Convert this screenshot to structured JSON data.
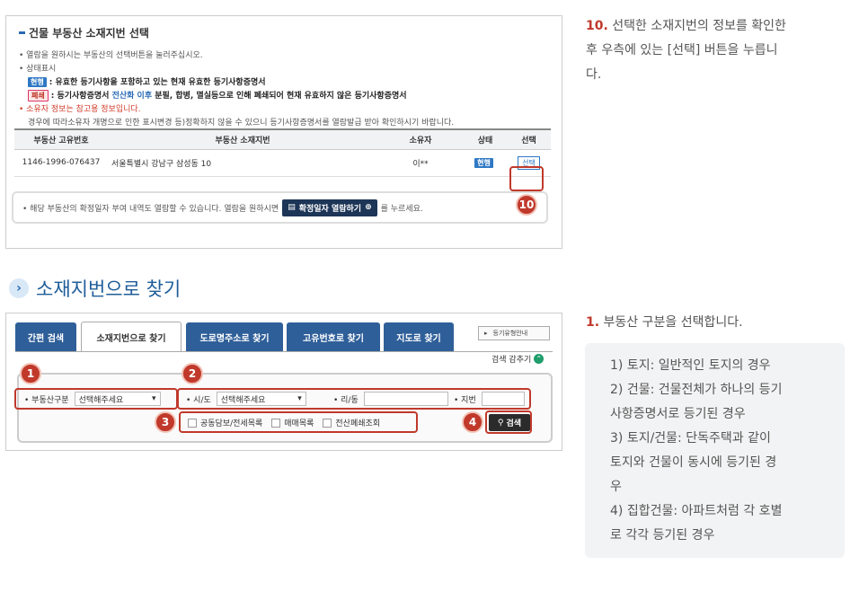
{
  "panel1": {
    "title": "건물 부동산 소재지번 선택",
    "notes": {
      "n1": "• 열람을 원하시는 부동산의 선택버튼을 눌러주십시오.",
      "n2": "• 상태표시",
      "badge_valid": "현행",
      "n3_bold": ": 유효한 등기사항을 포함하고 있는 현재 유효한 등기사항증명서",
      "badge_closed": "폐쇄",
      "n4_a": ": 등기사항증명서 ",
      "n4_b": "전산화 이후",
      "n4_c": " 분필, 합병, 멸실등으로 인해 폐쇄되어 현재 유효하지 않은 등기사항증명서",
      "n5": "• 소유자 정보는 참고용 정보입니다.",
      "n6": "경우에 따라소유자 개명으로 인한 표시변경 등)정확하지 않을 수 있으니 등기사항증명서를 열람발급 받아 확인하시기 바랍니다."
    },
    "table": {
      "headers": [
        "부동산 고유번호",
        "부동산 소재지번",
        "소유자",
        "상태",
        "선택"
      ],
      "row": {
        "id": "1146-1996-076437",
        "address": "서울특별시 강남구 삼성동 10",
        "owner": "이**",
        "status": "현행",
        "select": "선택"
      }
    },
    "step10": "10",
    "info": {
      "text_a": "• 해당 부동산의 확정일자 부여 내역도 열람할 수 있습니다. 열람을 원하시면",
      "button": "확정일자 열람하기",
      "text_b": "를 누르세요."
    }
  },
  "right1": {
    "num": "10.",
    "line1": " 선택한 소재지번의 정보를 확인한",
    "line2": "후 우측에 있는 [선택] 버튼을 누릅니",
    "line3": "다."
  },
  "section": {
    "title": "소재지번으로 찾기",
    "icon": "chevron-right-icon"
  },
  "panel2": {
    "tabs": [
      "간편 검색",
      "소재지번으로 찾기",
      "도로명주소로 찾기",
      "고유번호로 찾기",
      "지도로 찾기"
    ],
    "guide": "등기유형안내",
    "hide": "검색 감추기",
    "steps": [
      "1",
      "2",
      "3",
      "4"
    ],
    "type_label": "• 부동산구분",
    "type_value": "선택해주세요",
    "sido_label": "• 시/도",
    "sido_value": "선택해주세요",
    "ri_label": "• 리/동",
    "jibun_label": "• 지번",
    "checks": [
      "공동담보/전세목록",
      "매매목록",
      "전산폐쇄조회"
    ],
    "search": "검색"
  },
  "right2": {
    "num": "1.",
    "head": " 부동산 구분을 선택합니다.",
    "lines": [
      "1) 토지: 일반적인 토지의 경우",
      "2) 건물: 건물전체가 하나의 등기",
      "사항증명서로 등기된 경우",
      "3) 토지/건물: 단독주택과 같이",
      "토지와 건물이 동시에 등기된 경",
      "우",
      "4) 집합건물: 아파트처럼 각 호별",
      "로 각각 등기된 경우"
    ]
  },
  "colors": {
    "accent": "#c0392b",
    "tab": "#2f5f99",
    "link": "#2a6bb5"
  }
}
